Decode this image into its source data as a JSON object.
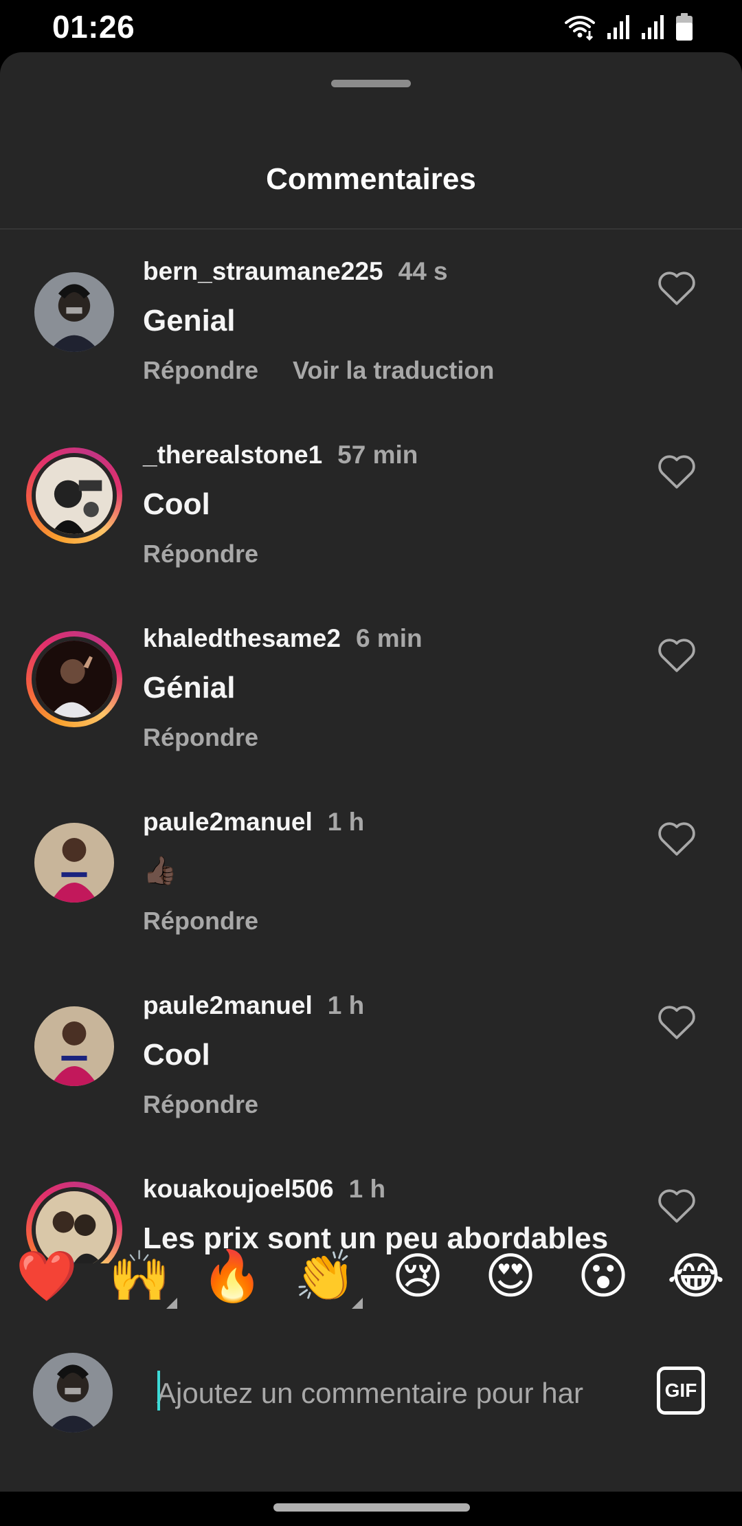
{
  "status": {
    "time": "01:26",
    "icons": [
      "wifi-icon",
      "signal-icon",
      "signal-icon",
      "battery-icon"
    ]
  },
  "sheet": {
    "title": "Commentaires"
  },
  "comments": [
    {
      "username": "bern_straumane225",
      "time": "44 s",
      "text": "Genial",
      "reply": "Répondre",
      "translate": "Voir la traduction",
      "story_ring": false
    },
    {
      "username": "_therealstone1",
      "time": "57 min",
      "text": "Cool",
      "reply": "Répondre",
      "story_ring": true
    },
    {
      "username": "khaledthesame2",
      "time": "6 min",
      "text": "Génial",
      "reply": "Répondre",
      "story_ring": true
    },
    {
      "username": "paule2manuel",
      "time": "1 h",
      "text": "👍🏿",
      "reply": "Répondre",
      "story_ring": false
    },
    {
      "username": "paule2manuel",
      "time": "1 h",
      "text": "Cool",
      "reply": "Répondre",
      "story_ring": false
    },
    {
      "username": "kouakoujoel506",
      "time": "1 h",
      "text": "Les prix sont un peu abordables",
      "story_ring": true
    }
  ],
  "reactions": [
    "❤️",
    "🙌",
    "🔥",
    "👏",
    "😢",
    "😍",
    "😮",
    "😂"
  ],
  "composer": {
    "placeholder": "Ajoutez un commentaire pour har",
    "gif_label": "GIF"
  },
  "colors": {
    "sheet_bg": "#262626",
    "secondary_text": "#a8a8a8",
    "caret": "#3ddad7"
  }
}
